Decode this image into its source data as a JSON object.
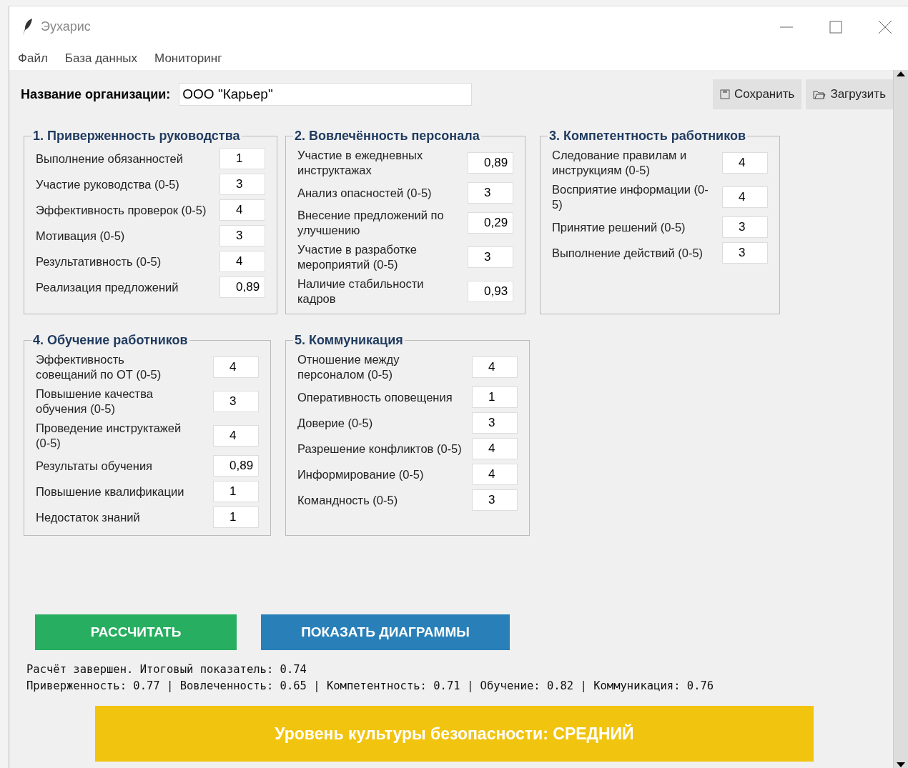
{
  "window": {
    "title": "Эухарис"
  },
  "menu": [
    "Файл",
    "База данных",
    "Мониторинг"
  ],
  "org": {
    "label": "Название организации:",
    "value": "ООО \"Карьер\""
  },
  "toolbar": [
    {
      "kind": "save",
      "label": "Сохранить"
    },
    {
      "kind": "load",
      "label": "Загрузить"
    }
  ],
  "groups": [
    {
      "title": "1. Приверженность руководства",
      "fields": [
        {
          "label": "Выполнение обязанностей",
          "value": "1"
        },
        {
          "label": "Участие руководства (0-5)",
          "value": "3"
        },
        {
          "label": "Эффективность проверок (0-5)",
          "value": "4"
        },
        {
          "label": "Мотивация (0-5)",
          "value": "3"
        },
        {
          "label": "Результативность (0-5)",
          "value": "4"
        },
        {
          "label": "Реализация предложений",
          "value": "0,89"
        }
      ]
    },
    {
      "title": "2. Вовлечённость персонала",
      "fields": [
        {
          "label": "Участие в ежедневных инструктажах",
          "value": "0,89"
        },
        {
          "label": "Анализ опасностей (0-5)",
          "value": "3"
        },
        {
          "label": "Внесение предложений по улучшению",
          "value": "0,29"
        },
        {
          "label": "Участие в разработке мероприятий (0-5)",
          "value": "3"
        },
        {
          "label": "Наличие стабильности кадров",
          "value": "0,93"
        }
      ]
    },
    {
      "title": "3. Компетентность работников",
      "fields": [
        {
          "label": "Следование правилам и инструкциям (0-5)",
          "value": "4"
        },
        {
          "label": "Восприятие информации (0-5)",
          "value": "4"
        },
        {
          "label": "Принятие решений (0-5)",
          "value": "3"
        },
        {
          "label": "Выполнение действий (0-5)",
          "value": "3"
        }
      ]
    },
    {
      "title": "4. Обучение работников",
      "fields": [
        {
          "label": "Эффективность совещаний по ОТ (0-5)",
          "value": "4"
        },
        {
          "label": "Повышение качества обучения (0-5)",
          "value": "3"
        },
        {
          "label": "Проведение инструктажей (0-5)",
          "value": "4"
        },
        {
          "label": "Результаты обучения",
          "value": "0,89"
        },
        {
          "label": "Повышение квалификации",
          "value": "1"
        },
        {
          "label": "Недостаток знаний",
          "value": "1"
        }
      ]
    },
    {
      "title": "5. Коммуникация",
      "fields": [
        {
          "label": "Отношение между персоналом (0-5)",
          "value": "4"
        },
        {
          "label": "Оперативность оповещения",
          "value": "1"
        },
        {
          "label": "Доверие (0-5)",
          "value": "3"
        },
        {
          "label": "Разрешение конфликтов (0-5)",
          "value": "4"
        },
        {
          "label": "Информирование (0-5)",
          "value": "4"
        },
        {
          "label": "Командность (0-5)",
          "value": "3"
        }
      ]
    }
  ],
  "actions": [
    {
      "kind": "calculate",
      "label": "РАССЧИТАТЬ"
    },
    {
      "kind": "charts",
      "label": "ПОКАЗАТЬ ДИАГРАММЫ"
    }
  ],
  "result": [
    "Расчёт завершен. Итоговый показатель: 0.74",
    "Приверженность: 0.77 | Вовлеченность: 0.65 | Компетентность: 0.71 | Обучение: 0.82 | Коммуникация: 0.76"
  ],
  "level_banner": {
    "text": "Уровень культуры безопасности: СРЕДНИЙ",
    "color": "#f1c40f"
  }
}
